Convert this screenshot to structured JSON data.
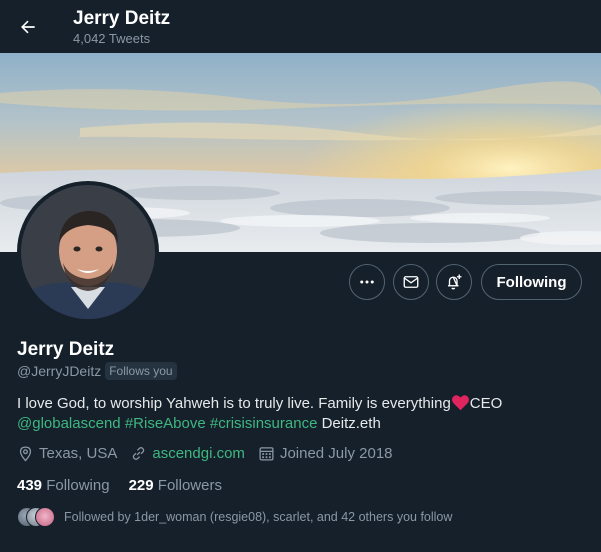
{
  "header": {
    "title": "Jerry Deitz",
    "tweet_count": "4,042 Tweets"
  },
  "profile": {
    "display_name": "Jerry Deitz",
    "handle": "@JerryJDeitz",
    "follows_you_badge": "Follows you",
    "bio": {
      "line1_text": "I love God, to worship Yahweh is to truly live. Family is everything",
      "line1_suffix": "CEO",
      "mention": "@globalascend",
      "hashtag1": "#RiseAbove",
      "hashtag2": "#crisisinsurance",
      "ens": "Deitz.eth"
    },
    "location": "Texas, USA",
    "website": "ascendgi.com",
    "joined": "Joined July 2018",
    "following_count": "439",
    "following_label": "Following",
    "followers_count": "229",
    "followers_label": "Followers",
    "followed_by": "Followed by 1der_woman (resgie08), scarlet, and 42 others you follow"
  },
  "actions": {
    "following_button": "Following"
  },
  "colors": {
    "background": "#15202b",
    "link": "#3eb780",
    "secondary_text": "#8b98a5",
    "border": "#536471",
    "heart": "#e0245e"
  },
  "icons": {
    "back": "arrow-left-icon",
    "more": "more-dots-icon",
    "message": "envelope-icon",
    "notify": "bell-plus-icon",
    "location": "location-pin-icon",
    "website": "link-icon",
    "joined": "calendar-icon"
  }
}
